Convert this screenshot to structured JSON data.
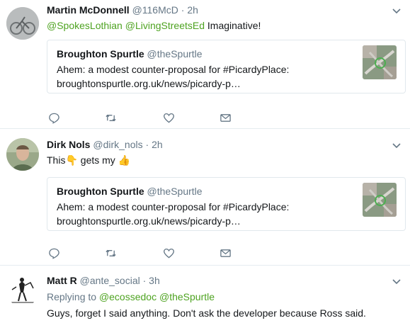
{
  "tweets": [
    {
      "name": "Martin McDonnell",
      "handle": "@116McD",
      "dot": "·",
      "time": "2h",
      "mentions": [
        "@SpokesLothian",
        "@LivingStreetsEd"
      ],
      "text_after": "Imaginative!",
      "card": {
        "name": "Broughton Spurtle",
        "handle": "@theSpurtle",
        "line1": "Ahem: a modest counter-proposal for #PicardyPlace:",
        "line2": "broughtonspurtle.org.uk/news/picardy-p…"
      }
    },
    {
      "name": "Dirk Nols",
      "handle": "@dirk_nols",
      "dot": "·",
      "time": "2h",
      "text_before": "This",
      "text_mid": "gets my",
      "emoji1": "👇",
      "emoji2": "👍",
      "card": {
        "name": "Broughton Spurtle",
        "handle": "@theSpurtle",
        "line1": "Ahem: a modest counter-proposal for #PicardyPlace:",
        "line2": "broughtonspurtle.org.uk/news/picardy-p…"
      }
    },
    {
      "name": "Matt R",
      "handle": "@ante_social",
      "dot": "·",
      "time": "3h",
      "replying_label": "Replying to",
      "replying_to": [
        "@ecossedoc",
        "@theSpurtle"
      ],
      "text": "Guys, forget I said anything. Don't ask the developer because Ross said."
    }
  ],
  "icons": [
    "reply-icon",
    "retweet-icon",
    "like-icon",
    "message-icon",
    "caret-down-icon"
  ],
  "colors": {
    "mention": "#4ea321",
    "secondary": "#657786",
    "border": "#e6ecf0"
  }
}
